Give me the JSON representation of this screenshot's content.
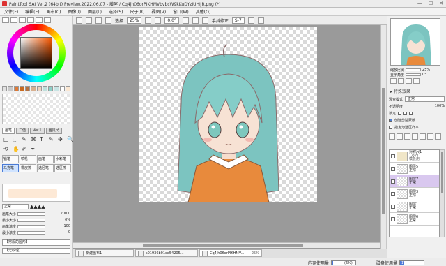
{
  "window": {
    "title": "PaintTool SAI Ver.2 (64bit) Preview.2022.06.07 - 藤屋 / Cq4jh06orPIKHMVbvbcW9kKuDYzIUHIJR.png (*)",
    "controls": [
      "—",
      "☐",
      "✕"
    ]
  },
  "menu": [
    "文件(F)",
    "编辑(E)",
    "画布(C)",
    "图像(I)",
    "图层(L)",
    "选择(S)",
    "尺子(R)",
    "视图(V)",
    "窗口(W)",
    "其他(O)"
  ],
  "left_panel": {
    "swatches": [
      "#e2e2e2",
      "#c9c9c9",
      "#e07a35",
      "#c96a20",
      "#b77140",
      "#d8b090",
      "#eed4c0",
      "#bfe0dc",
      "#8dd0c8",
      "#c8e4e4",
      "#ffffff",
      "#fbe7d2"
    ],
    "tool_tabs": [
      "画笔",
      "二值",
      "Ver.1",
      "画具尺"
    ],
    "tools_row1": [
      "□",
      "⬚",
      "✎",
      "⌘",
      "T",
      "✎"
    ],
    "tools_row2": [
      "✥",
      "🔍",
      "⟲",
      "✋",
      "✐",
      "✒"
    ],
    "brushes": [
      {
        "label": "铅笔",
        "selected": false
      },
      {
        "label": "喷枪",
        "selected": false
      },
      {
        "label": "画笔",
        "selected": false
      },
      {
        "label": "水彩笔",
        "selected": false
      },
      {
        "label": "马克笔",
        "selected": true
      },
      {
        "label": "橡皮擦",
        "selected": false
      },
      {
        "label": "选区笔",
        "selected": false
      },
      {
        "label": "选区擦",
        "selected": false
      }
    ],
    "blend_mode": "正常",
    "params": [
      {
        "label": "画笔大小",
        "value": "200.0"
      },
      {
        "label": "最小大小",
        "value": "0%"
      },
      {
        "label": "画笔浓度",
        "value": "100"
      },
      {
        "label": "最小浓度",
        "value": "0"
      }
    ],
    "shape_dropdown": "【常规的圆形】",
    "texture_dropdown": "【无纹理】"
  },
  "canvas_toolbar": {
    "selection_label": "选择",
    "zoom": "25%",
    "rotation": "0.0°",
    "stabilizer_label": "手抖修正",
    "stabilizer": "S-7"
  },
  "document_tabs": [
    {
      "name": "新建画布1",
      "zoom": ""
    },
    {
      "name": "s01936b01ce54205...",
      "zoom": ""
    },
    {
      "name": "Cq4jh06orPIKHMV...",
      "zoom": "25%"
    }
  ],
  "status": {
    "memory_label": "内存使用量",
    "memory_value": "(6%)",
    "memory_pct": 6,
    "disk_label": "磁盘使用量",
    "disk_value": "17%",
    "disk_pct": 17
  },
  "right_panel": {
    "zoom_label": "缩放比例",
    "zoom_value": "25%",
    "angle_label": "显示角度",
    "angle_value": "0°",
    "effects_title": "▸ 特殊效果",
    "blend_label": "混合模式",
    "blend_value": "正常",
    "opacity_label": "不透明度",
    "opacity_value": "100%",
    "lock_label": "锁定",
    "clip_label": "创建剪贴蒙版",
    "clip_checked": true,
    "source_label": "指定为选区样本",
    "source_checked": false,
    "layers": [
      {
        "name": "对称尺1",
        "mode": "1方向",
        "sub": "模板用",
        "selected": false,
        "folder": true
      },
      {
        "name": "图层5",
        "mode": "正常",
        "sub": "",
        "selected": false,
        "folder": false
      },
      {
        "name": "图层7",
        "mode": "正常",
        "sub": "",
        "selected": true,
        "folder": false
      },
      {
        "name": "图层3",
        "mode": "正常",
        "sub": "",
        "selected": false,
        "folder": false
      },
      {
        "name": "图层1",
        "mode": "正常",
        "sub": "",
        "selected": false,
        "folder": false
      },
      {
        "name": "图层6",
        "mode": "正常",
        "sub": "",
        "selected": false,
        "folder": false
      }
    ]
  }
}
